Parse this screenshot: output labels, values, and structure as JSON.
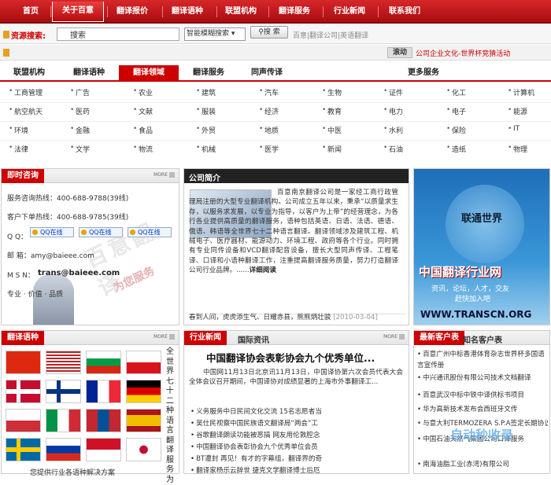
{
  "nav": {
    "items": [
      "首页",
      "关于百意",
      "翻译报价",
      "翻译语种",
      "联盟机构",
      "翻译服务",
      "行业新闻",
      "联系我们"
    ],
    "active": 1
  },
  "search": {
    "label": "资源搜索:",
    "value": "搜索",
    "mode": "智能模糊搜索",
    "button": "搜 索",
    "links": "百意|翻译公司|英语翻译"
  },
  "ticker": {
    "label": "滚动",
    "text": "公司企业文化-世界杯竞猜活动"
  },
  "tabs": {
    "items": [
      "联盟机构",
      "翻译语种",
      "翻译领域",
      "翻译服务",
      "同声传译",
      "更多服务"
    ],
    "active": 2
  },
  "categories": [
    [
      "工商管理",
      "广告",
      "农业",
      "建筑",
      "汽车",
      "生物",
      "证件",
      "化工",
      "计算机"
    ],
    [
      "航空航天",
      "医药",
      "文献",
      "服装",
      "经济",
      "教育",
      "电力",
      "电子",
      "能源"
    ],
    [
      "环境",
      "金融",
      "食品",
      "外贸",
      "地质",
      "中医",
      "水利",
      "保险",
      "IT"
    ],
    [
      "法律",
      "文学",
      "物流",
      "机械",
      "医学",
      "新闻",
      "石油",
      "造纸",
      "物理"
    ]
  ],
  "consult": {
    "title": "即时咨询",
    "more": "MORE",
    "hotline": "服务咨询热线：400-688-9788(39线)",
    "order": "客户下单热线：400-688-9785(39线)",
    "qq_label": "Q Q：",
    "qq_btn": "QQ在线",
    "email": "邮 箱：amy@baieee.com",
    "msn_label": "M S N：",
    "msn": "trans@baieee.com",
    "slogan": "专业 · 价值 · 品质",
    "watermark": "百意翻译",
    "watermark2": "为您服务"
  },
  "intro": {
    "title": "公司简介",
    "text": "百意南京翻译公司是一家经工商行政管理局注册的大型专业翻译机构。公司成立五年以来，秉承“以质量求生存，以服务求发展，以专业为指导，以客户为上帝”的经营理念，为各行各业提供高质量的翻译服务，语种包括英语、日语、法语、德语、俄语、韩语等全世界七十二种语言翻译。翻译领域涉及建筑工程、机械电子、医疗器材、能源动力、环境工程、政府等各个行业。同时拥有专业同传设备和VCD翻译配音设备，擅长大型同声传译、工程笔译、口译和小语种翻译工作，注重提高翻译服务质量，努力打造翻译公司行业品牌。......",
    "detail": "详细阅读",
    "bottom": "春到人间，虎虎添生气、日耀赤县，熊熊炳壮骏",
    "bottom_date": "[2010-03-04]"
  },
  "ad": {
    "line1": "联通世界",
    "line2": "中国翻译行业网",
    "line3": "资讯，论坛，人才，交友",
    "line4": "赶快加入吧",
    "url": "WWW.TRANSCN.ORG"
  },
  "lang": {
    "title": "翻译语种",
    "more": "MORE",
    "vertical": "全世界七十二种语言翻译服务为",
    "bottom": "您提供行业各语种解决方案"
  },
  "news": {
    "tab1": "行业新闻",
    "tab2": "国际资讯",
    "more": "MORE",
    "headline": "中国翻译协会表彰协会九个优秀单位...",
    "summary": "中国网11月13日北京讯11月13日，中国译协第六次会员代表大会全体会议召开期间，中国译协对成绩显著的上海市外事翻译工...",
    "items": [
      "义务服务中日民间文化交流 15名志愿者当",
      "吴仕民视察中国民族语文翻译局“两会”工",
      "谷歌翻译朗读功能被恶搞 网友用伦敦腔念",
      "中国翻译协会表彰协会九个优秀单位会员",
      "BT遭封 再见！有才的字幕组，翻译界的奇",
      "翻译家杨乐云辞世 捷克文学翻译博士后厄"
    ]
  },
  "clients": {
    "tab1": "最新客户表",
    "tab2": "知名客户表",
    "items": [
      "百意广州中标香港体育杂志世界杯多国语言宣传册",
      "中兴通讯股份有限公司技术文档翻译",
      "百意武汉中标中铁中译供标书项目",
      "华为高新技术发布会西班牙文传",
      "与意大利TERMOZERA S.P.A签定长期协议",
      "中国石油天然气集团公司口译服务",
      "南海油脂工业(赤湾)有限公司"
    ],
    "watermark": "自动秒收录"
  },
  "colors": {
    "brand": "#c00000",
    "link": "#0033cc"
  }
}
